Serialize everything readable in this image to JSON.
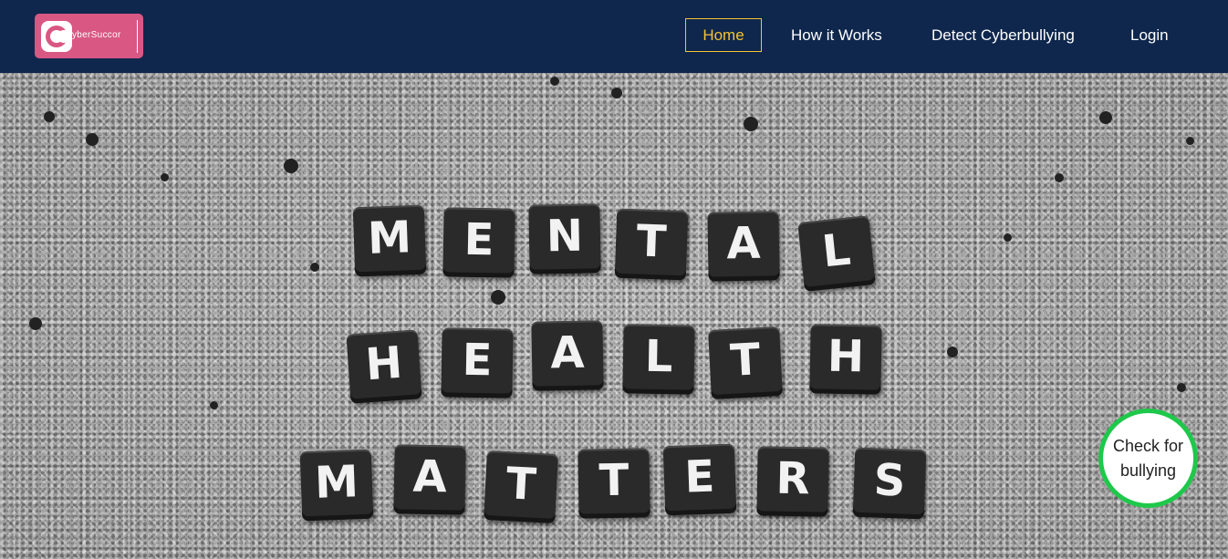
{
  "navbar": {
    "logo": {
      "mark": "C",
      "text": "yberSuccor"
    },
    "items": [
      {
        "label": "Home",
        "active": true
      },
      {
        "label": "How it Works",
        "active": false
      },
      {
        "label": "Detect Cyberbullying",
        "active": false
      },
      {
        "label": "Login",
        "active": false
      }
    ]
  },
  "hero": {
    "lines": [
      [
        "M",
        "E",
        "N",
        "T",
        "A",
        "L"
      ],
      [
        "H",
        "E",
        "A",
        "L",
        "T",
        "H"
      ],
      [
        "M",
        "A",
        "T",
        "T",
        "E",
        "R",
        "S"
      ]
    ]
  },
  "fab": {
    "line1": "Check for",
    "line2": "bullying"
  },
  "colors": {
    "navbar_bg": "#0f274d",
    "logo_bg": "#d95783",
    "active_nav": "#f4c431",
    "fab_border": "#1ec84a"
  }
}
